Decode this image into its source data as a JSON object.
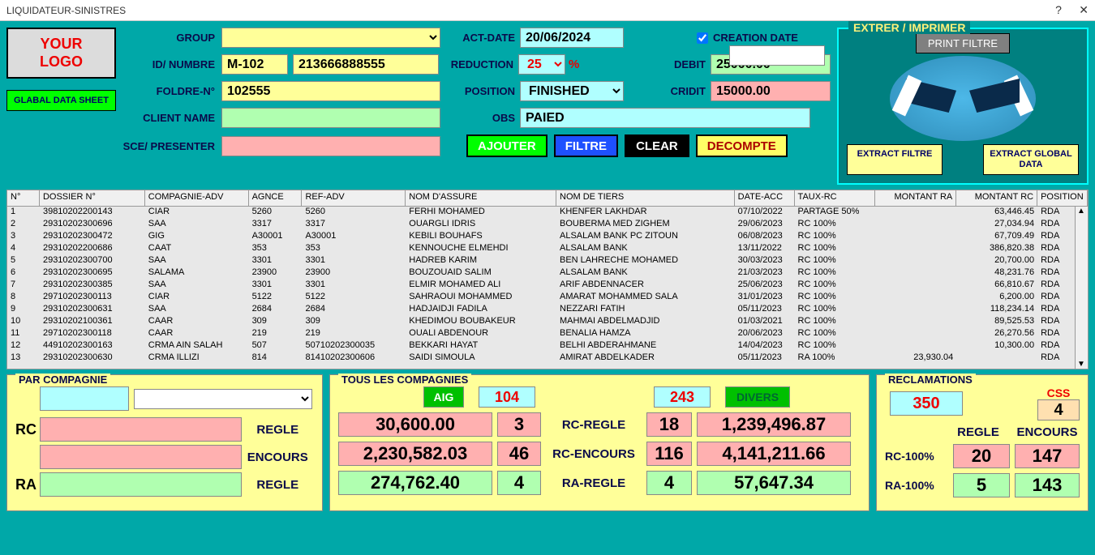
{
  "window": {
    "title": "LIQUIDATEUR-SINISTRES"
  },
  "logo": {
    "line1": "YOUR",
    "line2": "LOGO"
  },
  "buttons": {
    "glabal": "GLABAL DATA SHEET",
    "ajouter": "AJOUTER",
    "filtre": "FILTRE",
    "clear": "CLEAR",
    "decompte": "DECOMPTE",
    "print": "PRINT FILTRE",
    "extract_filtre": "EXTRACT FILTRE",
    "extract_global": "EXTRACT GLOBAL DATA"
  },
  "labels": {
    "group": "GROUP",
    "id": "ID/ NUMBRE",
    "foldre": "FOLDRE-N°",
    "client": "CLIENT NAME",
    "sce": "SCE/ PRESENTER",
    "actdate": "ACT-DATE",
    "reduction": "REDUCTION",
    "pct": "%",
    "position": "POSITION",
    "obs": "OBS",
    "creation": "CREATION DATE",
    "debit": "DEBIT",
    "cridit": "CRIDIT",
    "extrer": "EXTRER / IMPRIMER"
  },
  "form": {
    "group": "",
    "id": "M-102",
    "phone": "213666888555",
    "foldre": "102555",
    "client": "",
    "sce": "",
    "actdate": "20/06/2024",
    "reduction": "25",
    "position": "FINISHED",
    "obs": "PAIED",
    "debit": "25000.00",
    "cridit": "15000.00",
    "creation": ""
  },
  "grid": {
    "headers": [
      "N°",
      "DOSSIER N°",
      "COMPAGNIE-ADV",
      "AGNCE",
      "REF-ADV",
      "NOM D'ASSURE",
      "NOM DE TIERS",
      "DATE-ACC",
      "TAUX-RC",
      "MONTANT RA",
      "MONTANT RC",
      "POSITION"
    ],
    "rows": [
      [
        "1",
        "39810202200143",
        "CIAR",
        "5260",
        "5260",
        "FERHI MOHAMED",
        "KHENFER LAKHDAR",
        "07/10/2022",
        "PARTAGE 50%",
        "",
        "63,446.45",
        "RDA"
      ],
      [
        "2",
        "29310202300696",
        "SAA",
        "3317",
        "3317",
        "OUARGLI IDRIS",
        "BOUBERMA MED ZIGHEM",
        "29/06/2023",
        "RC 100%",
        "",
        "27,034.94",
        "RDA"
      ],
      [
        "3",
        "29310202300472",
        "GIG",
        "A30001",
        "A30001",
        "KEBILI BOUHAFS",
        "ALSALAM BANK PC ZITOUN",
        "06/08/2023",
        "RC 100%",
        "",
        "67,709.49",
        "RDA"
      ],
      [
        "4",
        "29310202200686",
        "CAAT",
        "353",
        "353",
        "KENNOUCHE ELMEHDI",
        "ALSALAM BANK",
        "13/11/2022",
        "RC 100%",
        "",
        "386,820.38",
        "RDA"
      ],
      [
        "5",
        "29310202300700",
        "SAA",
        "3301",
        "3301",
        "HADREB KARIM",
        "BEN LAHRECHE MOHAMED",
        "30/03/2023",
        "RC 100%",
        "",
        "20,700.00",
        "RDA"
      ],
      [
        "6",
        "29310202300695",
        "SALAMA",
        "23900",
        "23900",
        "BOUZOUAID SALIM",
        "ALSALAM BANK",
        "21/03/2023",
        "RC 100%",
        "",
        "48,231.76",
        "RDA"
      ],
      [
        "7",
        "29310202300385",
        "SAA",
        "3301",
        "3301",
        "ELMIR MOHAMED ALI",
        "ARIF ABDENNACER",
        "25/06/2023",
        "RC 100%",
        "",
        "66,810.67",
        "RDA"
      ],
      [
        "8",
        "29710202300113",
        "CIAR",
        "5122",
        "5122",
        "SAHRAOUI MOHAMMED",
        "AMARAT MOHAMMED SALA",
        "31/01/2023",
        "RC 100%",
        "",
        "6,200.00",
        "RDA"
      ],
      [
        "9",
        "29310202300631",
        "SAA",
        "2684",
        "2684",
        "HADJAIDJI FADILA",
        "NEZZARI FATIH",
        "05/11/2023",
        "RC 100%",
        "",
        "118,234.14",
        "RDA"
      ],
      [
        "10",
        "29310202100361",
        "CAAR",
        "309",
        "309",
        "KHEDIMOU BOUBAKEUR",
        "MAHMAI ABDELMADJID",
        "01/03/2021",
        "RC 100%",
        "",
        "89,525.53",
        "RDA"
      ],
      [
        "11",
        "29710202300118",
        "CAAR",
        "219",
        "219",
        "OUALI ABDENOUR",
        "BENALIA HAMZA",
        "20/06/2023",
        "RC 100%",
        "",
        "26,270.56",
        "RDA"
      ],
      [
        "12",
        "44910202300163",
        "CRMA AIN SALAH",
        "507",
        "50710202300035",
        "BEKKARI HAYAT",
        "BELHI ABDERAHMANE",
        "14/04/2023",
        "RC 100%",
        "",
        "10,300.00",
        "RDA"
      ],
      [
        "13",
        "29310202300630",
        "CRMA ILLIZI",
        "814",
        "81410202300606",
        "SAIDI SIMOULA",
        "AMIRAT ABDELKADER",
        "05/11/2023",
        "RA 100%",
        "23,930.04",
        "",
        "RDA"
      ]
    ]
  },
  "panel1": {
    "title": "PAR  COMPAGNIE",
    "rc": "RC",
    "ra": "RA",
    "regle": "REGLE",
    "encours": "ENCOURS"
  },
  "panel2": {
    "title": "TOUS LES COMPAGNIES",
    "aig": "AIG",
    "aig_n": "104",
    "divers": "DIVERS",
    "divers_n": "243",
    "rows": [
      {
        "amt": "30,600.00",
        "cnt": "3",
        "label": "RC-REGLE",
        "cnt2": "18",
        "amt2": "1,239,496.87",
        "bg": "pink"
      },
      {
        "amt": "2,230,582.03",
        "cnt": "46",
        "label": "RC-ENCOURS",
        "cnt2": "116",
        "amt2": "4,141,211.66",
        "bg": "pink"
      },
      {
        "amt": "274,762.40",
        "cnt": "4",
        "label": "RA-REGLE",
        "cnt2": "4",
        "amt2": "57,647.34",
        "bg": "green"
      }
    ]
  },
  "panel3": {
    "title": "RECLAMATIONS",
    "css": "CSS",
    "n350": "350",
    "n4": "4",
    "regle": "REGLE",
    "encours": "ENCOURS",
    "rows": [
      {
        "label": "RC-100%",
        "r": "20",
        "e": "147",
        "bg": "pink"
      },
      {
        "label": "RA-100%",
        "r": "5",
        "e": "143",
        "bg": "green"
      }
    ]
  }
}
